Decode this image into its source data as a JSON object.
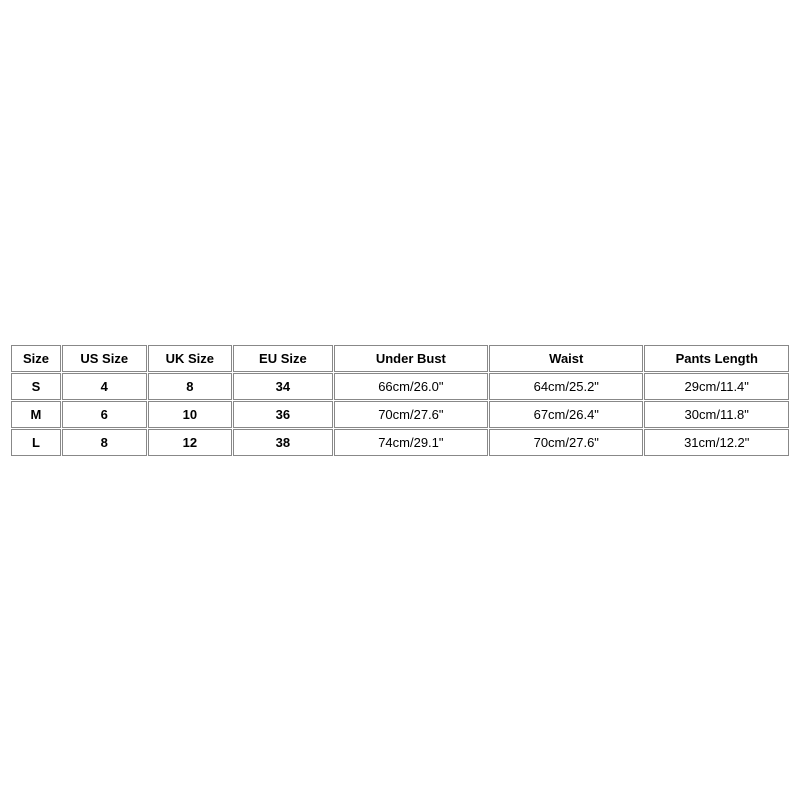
{
  "chart_data": {
    "type": "table",
    "headers": [
      "Size",
      "US Size",
      "UK Size",
      "EU Size",
      "Under Bust",
      "Waist",
      "Pants Length"
    ],
    "rows": [
      {
        "size": "S",
        "us": "4",
        "uk": "8",
        "eu": "34",
        "underbust": "66cm/26.0\"",
        "waist": "64cm/25.2\"",
        "pants": "29cm/11.4\""
      },
      {
        "size": "M",
        "us": "6",
        "uk": "10",
        "eu": "36",
        "underbust": "70cm/27.6\"",
        "waist": "67cm/26.4\"",
        "pants": "30cm/11.8\""
      },
      {
        "size": "L",
        "us": "8",
        "uk": "12",
        "eu": "38",
        "underbust": "74cm/29.1\"",
        "waist": "70cm/27.6\"",
        "pants": "31cm/12.2\""
      }
    ]
  }
}
